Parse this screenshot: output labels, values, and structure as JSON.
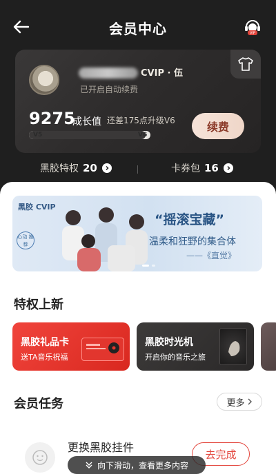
{
  "header": {
    "title": "会员中心",
    "back_icon": "back-arrow-icon",
    "service_icon": "vip-service-icon",
    "service_badge": "VIP"
  },
  "member": {
    "vip_badge": "CVIP · 伍",
    "auto_renew": "已开启自动续费",
    "growth_value": "9275",
    "growth_label": "成长值",
    "growth_hint": "还差175点升级V6",
    "level_from": "V5",
    "level_to": "V6",
    "progress": 0.96,
    "renew_button": "续费",
    "shirt_icon": "tshirt-icon"
  },
  "stats": {
    "privileges_label": "黑胶特权",
    "privileges_count": "20",
    "coupons_label": "卡券包",
    "coupons_count": "16"
  },
  "banner": {
    "logo": "黑胶 CVIP",
    "sticker": "心动 推荐",
    "title": "“摇滚宝藏”",
    "subtitle": "温柔和狂野的集合体",
    "tag": "——《直觉》"
  },
  "new_privileges": {
    "title": "特权上新",
    "cards": [
      {
        "title": "黑胶礼品卡",
        "subtitle": "送TA音乐祝福"
      },
      {
        "title": "黑胶时光机",
        "subtitle": "开启你的音乐之旅"
      }
    ]
  },
  "tasks": {
    "title": "会员任务",
    "more_button": "更多",
    "item_title": "更换黑胶挂件",
    "item_button": "去完成"
  },
  "toast": {
    "text": "向下滑动，查看更多内容"
  },
  "colors": {
    "accent_red": "#e3453c",
    "renew_text": "#8c3b2a",
    "banner_text": "#2a5585"
  }
}
